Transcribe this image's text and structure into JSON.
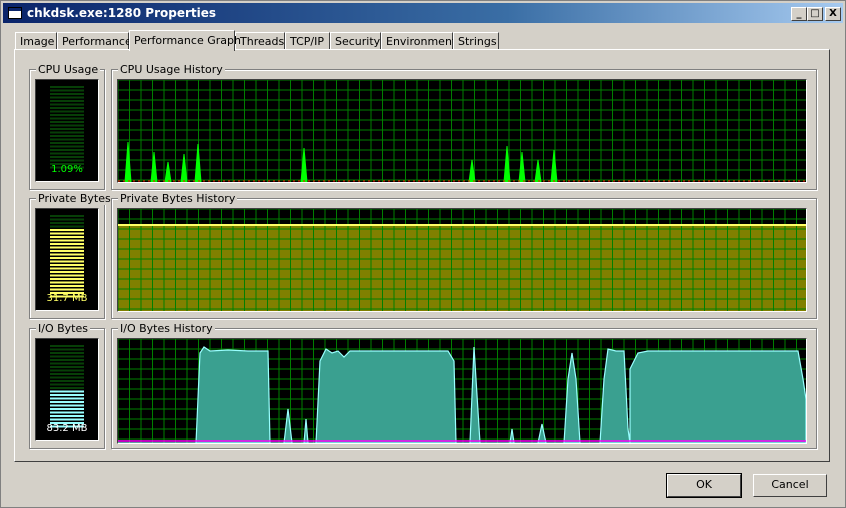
{
  "window": {
    "title": "chkdsk.exe:1280 Properties",
    "controls": {
      "minimize": "_",
      "maximize": "□",
      "close": "X"
    }
  },
  "tabs": [
    {
      "label": "Image"
    },
    {
      "label": "Performance"
    },
    {
      "label": "Performance Graph",
      "active": true
    },
    {
      "label": "Threads"
    },
    {
      "label": "TCP/IP"
    },
    {
      "label": "Security"
    },
    {
      "label": "Environment"
    },
    {
      "label": "Strings"
    }
  ],
  "cpu": {
    "meter_label": "CPU Usage",
    "history_label": "CPU Usage History",
    "value_text": "1.09%",
    "level": 0.011,
    "color": "#00ff00",
    "history": [
      0,
      0,
      0,
      0,
      0,
      0,
      0,
      0,
      0,
      35,
      0,
      0,
      0,
      0,
      0,
      0,
      0,
      0,
      0,
      0,
      0,
      0,
      0,
      30,
      0,
      0,
      0,
      0,
      0,
      0,
      0,
      0,
      0,
      0,
      0,
      0,
      0,
      0,
      20,
      0,
      0,
      0,
      0,
      0,
      0,
      0,
      0,
      28,
      0,
      0,
      0,
      0,
      0,
      0,
      0,
      0,
      0,
      0,
      0,
      0,
      0,
      0,
      0,
      0,
      0,
      0,
      0,
      0,
      0,
      0,
      0,
      0,
      0,
      0,
      0,
      0,
      0,
      0,
      0,
      0,
      0,
      0,
      0,
      0,
      0,
      0,
      0,
      0,
      0,
      0,
      0,
      0,
      0,
      0,
      0,
      0,
      0,
      0,
      0,
      0,
      0,
      0,
      0,
      0,
      0,
      0,
      0,
      0,
      0,
      0,
      0,
      0,
      0,
      0,
      0,
      0,
      0,
      0,
      0,
      0,
      0,
      0,
      0,
      0,
      0,
      0,
      0,
      0,
      0,
      0,
      0,
      0,
      0,
      0,
      0,
      0,
      0,
      0,
      0,
      0,
      0,
      0,
      0,
      0,
      0,
      0,
      0,
      0,
      0,
      0,
      0,
      0,
      0,
      0,
      0,
      0,
      0,
      0,
      0,
      0,
      0,
      0,
      0,
      0,
      0,
      0,
      0,
      0,
      0,
      0,
      0,
      0,
      0,
      0,
      0,
      0,
      0,
      0,
      0,
      0,
      0,
      0,
      0,
      0,
      0,
      0,
      0,
      0,
      0,
      0,
      0,
      0,
      0,
      0,
      0,
      0,
      0,
      0,
      0,
      0,
      0,
      0,
      0,
      0,
      0,
      0,
      0,
      0,
      0,
      0,
      0,
      0,
      0,
      0,
      0,
      0,
      0,
      0,
      0,
      0,
      0,
      0,
      0,
      0,
      0,
      0,
      0,
      0,
      0,
      0,
      0,
      0,
      0,
      0,
      0,
      0,
      0,
      0,
      0,
      0,
      0,
      0,
      0,
      0,
      0,
      0,
      0,
      0,
      0,
      0,
      0,
      0,
      0,
      0,
      0,
      0,
      0,
      0,
      0,
      0,
      0,
      0,
      0,
      0,
      0,
      0,
      0,
      0,
      0,
      0,
      0,
      0,
      0,
      0,
      0,
      0,
      0,
      0,
      0,
      0,
      0,
      0,
      0,
      0,
      0,
      0,
      0,
      0,
      0,
      0,
      0,
      0,
      0,
      0,
      0,
      0,
      0,
      0,
      0,
      0,
      0,
      0,
      0,
      0,
      0,
      0,
      0,
      0,
      0,
      0,
      0,
      0,
      0,
      0,
      0,
      0,
      0,
      0,
      0,
      0,
      0,
      0,
      0,
      0,
      0,
      0,
      0,
      0,
      0,
      0,
      0,
      0,
      0,
      0,
      0,
      0,
      0,
      0,
      0,
      0,
      0,
      0,
      0,
      0,
      0,
      0,
      0,
      0,
      0,
      0,
      0,
      0,
      0,
      0,
      0,
      0,
      0,
      0,
      0,
      0,
      0,
      0,
      0,
      0,
      0,
      0,
      0,
      0,
      0,
      0,
      0,
      0,
      0,
      0,
      0,
      0,
      0,
      0,
      0,
      0,
      0,
      0,
      0,
      0,
      0,
      0,
      0,
      0,
      0,
      0,
      0,
      0,
      0,
      0,
      0,
      0,
      0,
      0,
      0,
      0,
      0,
      0,
      0,
      0,
      0,
      0,
      0,
      0,
      0,
      0,
      0,
      0,
      0,
      0,
      0,
      0,
      0,
      0,
      0,
      0,
      0,
      0,
      0,
      0,
      0,
      0,
      0,
      0,
      0,
      0,
      0,
      0,
      0,
      0,
      0,
      0,
      0,
      0,
      0,
      0,
      0,
      0,
      0,
      0,
      0,
      0,
      0,
      0,
      0,
      0,
      0,
      0,
      0,
      0,
      0,
      0,
      0,
      0,
      0,
      0,
      0,
      0,
      0,
      0,
      0,
      0,
      0,
      0,
      0,
      0,
      0,
      0,
      0,
      0,
      0,
      0,
      0,
      0,
      0,
      0,
      0,
      0,
      0,
      0,
      0,
      0,
      0,
      0,
      0,
      0,
      0,
      0,
      0,
      0,
      0,
      0,
      0,
      0,
      0,
      0,
      0,
      0,
      0,
      0,
      0,
      0,
      0,
      0,
      0,
      0,
      0,
      0,
      0,
      0,
      0,
      0,
      0,
      0,
      0,
      0,
      0,
      0,
      0,
      0,
      0,
      0,
      0,
      0,
      0,
      0,
      0,
      0,
      0,
      0,
      0,
      0,
      0,
      0,
      0,
      0,
      0,
      0,
      0,
      0,
      0,
      0,
      0,
      0,
      0,
      0,
      0,
      0,
      0,
      0,
      0,
      0,
      0,
      0,
      0,
      0,
      0,
      0,
      0,
      0,
      0,
      0,
      0,
      0,
      0,
      0,
      0,
      0,
      0,
      0,
      0,
      0,
      0,
      0,
      0,
      0,
      0,
      0,
      0,
      0,
      0,
      0,
      0,
      0,
      0,
      0,
      0,
      0,
      0,
      0,
      0,
      0,
      0,
      0,
      0,
      0,
      0,
      0,
      0,
      0,
      0,
      0,
      0,
      0,
      0,
      0,
      0,
      0,
      0,
      0,
      0,
      0,
      0,
      0,
      0,
      0,
      0,
      0,
      0,
      0,
      0,
      0,
      0,
      0,
      0,
      0,
      0,
      0,
      0,
      0,
      0,
      0,
      0,
      0,
      0,
      0,
      0,
      0,
      0,
      0,
      0,
      0,
      0,
      0,
      0,
      0,
      0,
      0,
      0,
      0,
      0,
      0,
      0,
      0,
      0,
      0,
      0,
      0,
      0,
      0,
      0,
      0,
      0,
      0,
      0,
      0,
      0,
      0,
      0,
      0,
      0,
      0,
      0,
      0,
      0,
      0,
      0,
      0,
      0,
      0,
      0,
      0,
      0,
      0,
      0,
      0,
      0,
      0,
      0,
      0,
      0,
      0,
      0,
      0,
      0,
      0,
      0,
      0,
      0,
      0,
      0,
      0,
      0,
      0,
      0,
      0,
      0,
      0,
      0,
      0,
      0,
      0
    ]
  },
  "private_bytes": {
    "meter_label": "Private Bytes",
    "history_label": "Private Bytes History",
    "value_text": "31.7 MB",
    "level": 0.84,
    "color": "#ffff66",
    "fill": "#808000",
    "history_level": 0.84
  },
  "io_bytes": {
    "meter_label": "I/O Bytes",
    "history_label": "I/O Bytes History",
    "value_text": "83.2 MB",
    "level": 0.45,
    "color": "#99ffff",
    "fill": "#3aa090"
  },
  "buttons": {
    "ok": "OK",
    "cancel": "Cancel"
  }
}
